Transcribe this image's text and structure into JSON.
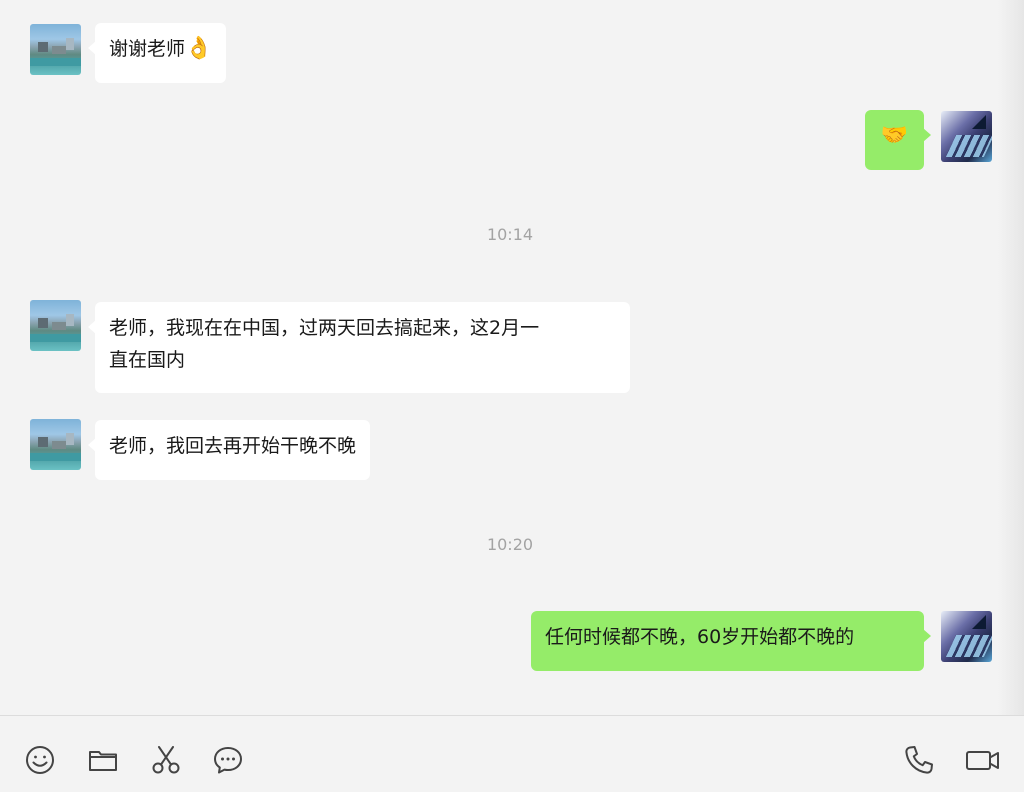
{
  "messages": [
    {
      "side": "left",
      "text": "谢谢老师",
      "emoji": "👌"
    },
    {
      "side": "right",
      "emoji": "🤝"
    },
    {
      "type": "time",
      "text": "10:14"
    },
    {
      "side": "left",
      "text_line1": "老师，我现在在中国，过两天回去搞起来，这2月一",
      "text_line2": "直在国内"
    },
    {
      "side": "left",
      "text": "老师，我回去再开始干晚不晚"
    },
    {
      "type": "time",
      "text": "10:20"
    },
    {
      "side": "right",
      "text": "任何时候都不晚，60岁开始都不晚的"
    }
  ],
  "toolbar": {
    "left_icons": [
      "emoji-icon",
      "folder-icon",
      "scissors-icon",
      "chat-bubble-icon"
    ],
    "right_icons": [
      "phone-icon",
      "video-camera-icon"
    ]
  },
  "colors": {
    "outgoing_bubble": "#95ec69",
    "incoming_bubble": "#ffffff",
    "background": "#f3f3f3",
    "timestamp": "#a3a3a3"
  }
}
